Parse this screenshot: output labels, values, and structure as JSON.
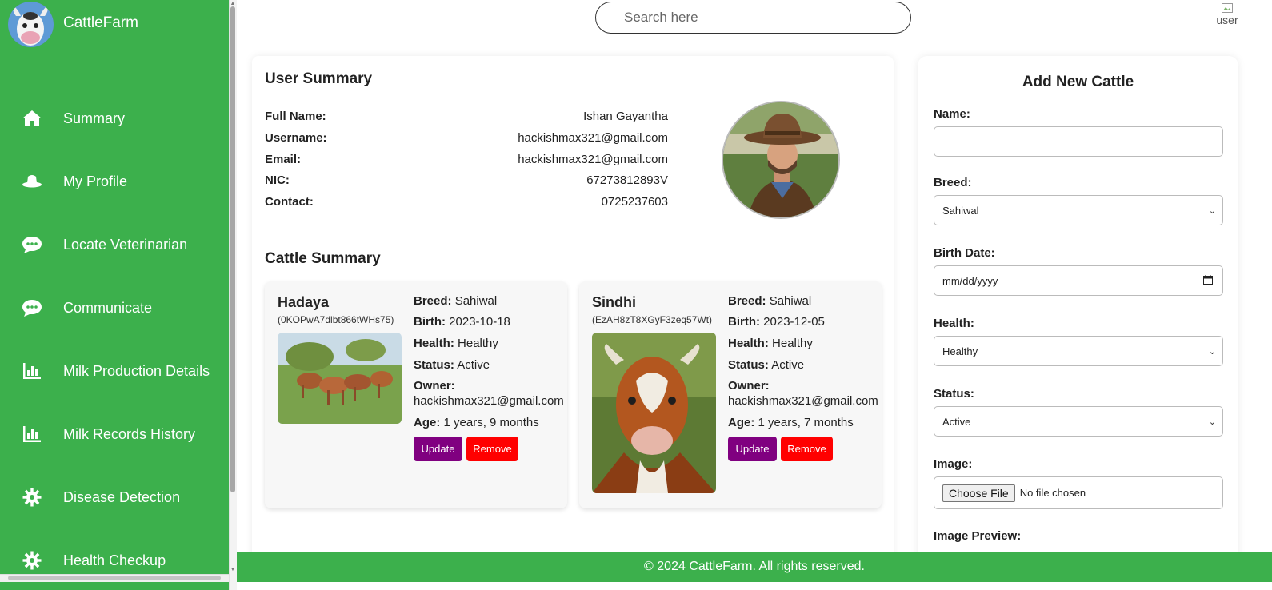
{
  "app": {
    "brand": "CattleFarm"
  },
  "sidebar": {
    "items": [
      {
        "label": "Summary",
        "icon": "home-icon"
      },
      {
        "label": "My Profile",
        "icon": "hat-icon"
      },
      {
        "label": "Locate Veterinarian",
        "icon": "chat-icon"
      },
      {
        "label": "Communicate",
        "icon": "chat-icon"
      },
      {
        "label": "Milk Production Details",
        "icon": "bar-chart-icon"
      },
      {
        "label": "Milk Records History",
        "icon": "bar-chart-icon"
      },
      {
        "label": "Disease Detection",
        "icon": "gear-icon"
      },
      {
        "label": "Health Checkup",
        "icon": "gear-icon"
      }
    ]
  },
  "header": {
    "search_placeholder": "Search here",
    "user_alt": "user"
  },
  "user_summary": {
    "title": "User Summary",
    "fields": [
      {
        "key": "Full Name:",
        "value": "Ishan Gayantha"
      },
      {
        "key": "Username:",
        "value": "hackishmax321@gmail.com"
      },
      {
        "key": "Email:",
        "value": "hackishmax321@gmail.com"
      },
      {
        "key": "NIC:",
        "value": "67273812893V"
      },
      {
        "key": "Contact:",
        "value": "0725237603"
      }
    ]
  },
  "cattle_summary": {
    "title": "Cattle Summary",
    "labels": {
      "breed": "Breed:",
      "birth": "Birth:",
      "health": "Health:",
      "status": "Status:",
      "owner": "Owner:",
      "age": "Age:"
    },
    "cattle": [
      {
        "name": "Hadaya",
        "id": "(0KOPwA7dlbt866tWHs75)",
        "breed": "Sahiwal",
        "birth": "2023-10-18",
        "health": "Healthy",
        "status": "Active",
        "owner": "hackishmax321@gmail.com",
        "age": "1 years, 9 months",
        "update": "Update",
        "remove": "Remove"
      },
      {
        "name": "Sindhi",
        "id": "(EzAH8zT8XGyF3zeq57Wt)",
        "breed": "Sahiwal",
        "birth": "2023-12-05",
        "health": "Healthy",
        "status": "Active",
        "owner": "hackishmax321@gmail.com",
        "age": "1 years, 7 months",
        "update": "Update",
        "remove": "Remove"
      }
    ]
  },
  "form": {
    "title": "Add New Cattle",
    "name_label": "Name:",
    "name_value": "",
    "breed_label": "Breed:",
    "breed_value": "Sahiwal",
    "birth_label": "Birth Date:",
    "birth_placeholder": "mm/dd/yyyy",
    "health_label": "Health:",
    "health_value": "Healthy",
    "status_label": "Status:",
    "status_value": "Active",
    "image_label": "Image:",
    "file_button": "Choose File",
    "file_text": "No file chosen",
    "preview_label": "Image Preview:"
  },
  "footer": {
    "text": "© 2024 CattleFarm. All rights reserved."
  },
  "colors": {
    "sidebar": "#3cb04c",
    "update": "#800080",
    "remove": "#ff0000"
  }
}
